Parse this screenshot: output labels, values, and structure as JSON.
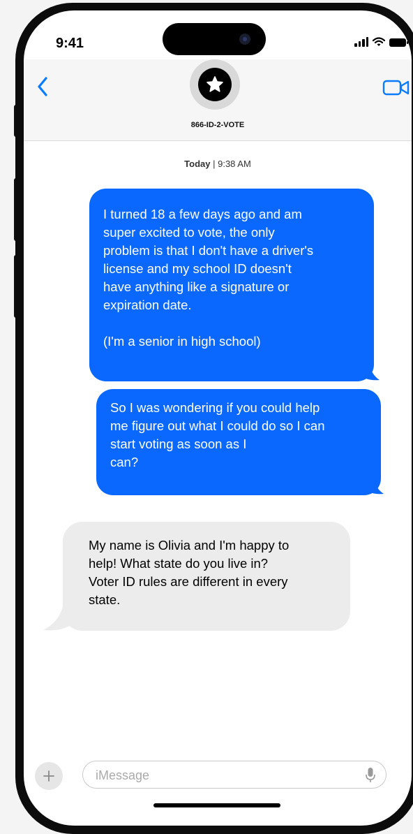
{
  "status_bar": {
    "time": "9:41"
  },
  "header": {
    "contact_name": "866-ID-2-VOTE"
  },
  "timestamp": {
    "day": "Today",
    "time": "| 9:38 AM"
  },
  "messages": [
    {
      "direction": "outgoing",
      "text": "I turned 18 a few days ago and am\nsuper excited to vote, the only\nproblem is that I don't have a driver's\nlicense and my school ID doesn't\nhave anything like a signature or\nexpiration date.\n\n(I'm a senior in high school)"
    },
    {
      "direction": "outgoing",
      "text": "So I was wondering if you could help\nme figure out what I could do so I can\nstart voting as soon as I\ncan?"
    },
    {
      "direction": "incoming",
      "text": "My name is Olivia and I'm happy to\nhelp! What state do you live in?\nVoter ID rules are different in every\nstate."
    }
  ],
  "input": {
    "placeholder": "iMessage"
  },
  "colors": {
    "outgoing_bubble": "#0a68fe",
    "incoming_bubble": "#ececec",
    "accent": "#0a7aff"
  },
  "icons": [
    "back-chevron-icon",
    "star-icon",
    "video-camera-icon",
    "plus-icon",
    "microphone-icon",
    "signal-icon",
    "wifi-icon",
    "battery-icon"
  ]
}
